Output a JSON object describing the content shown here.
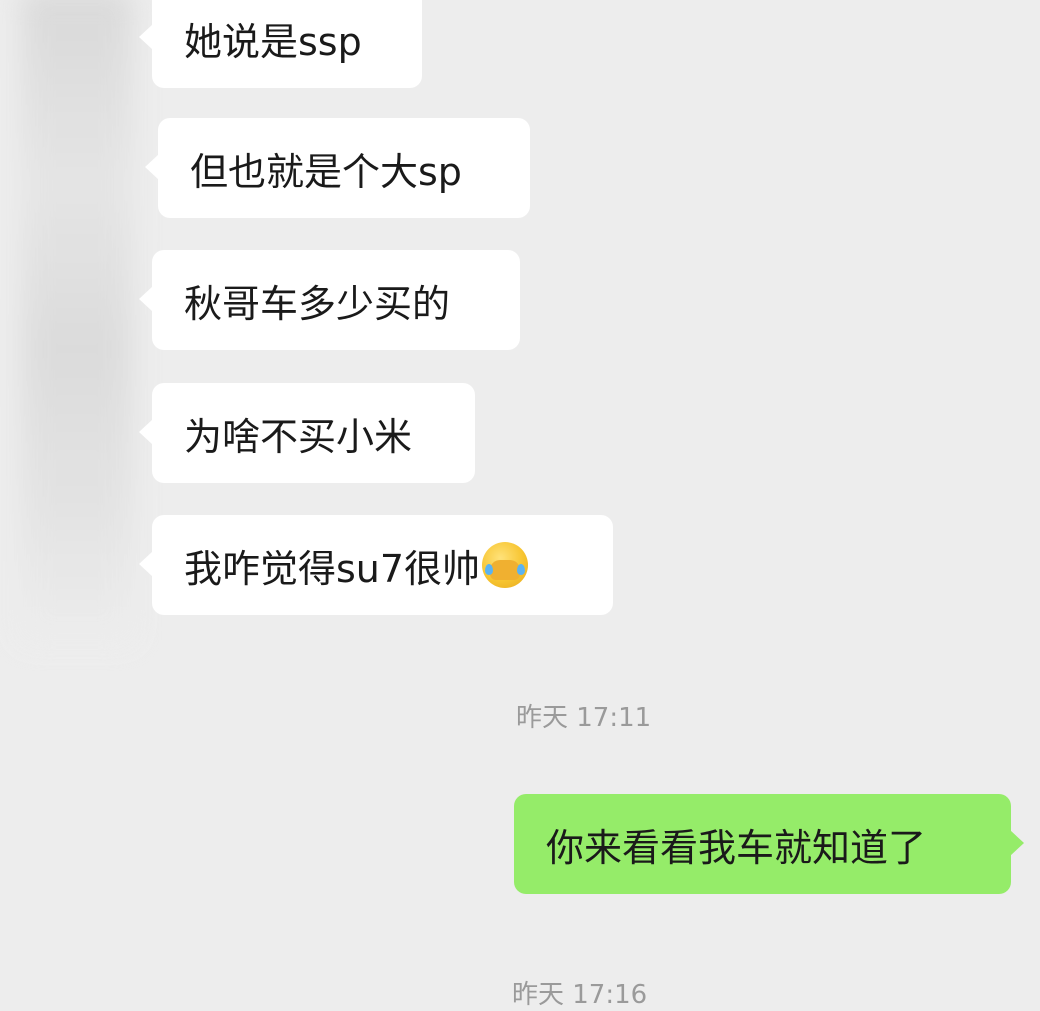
{
  "messages_received": [
    {
      "text": "她说是ssp"
    },
    {
      "text": "但也就是个大sp"
    },
    {
      "text": "秋哥车多少买的"
    },
    {
      "text": "为啥不买小米"
    },
    {
      "text": "我咋觉得su7很帅",
      "emoji": "face-with-tears-of-joy-covering-face-icon"
    }
  ],
  "timestamps": [
    "昨天 17:11",
    "昨天 17:16"
  ],
  "messages_sent": [
    {
      "text": "你来看看我车就知道了"
    }
  ],
  "colors": {
    "background": "#ededed",
    "received_bubble": "#ffffff",
    "sent_bubble": "#95ec69",
    "timestamp_text": "#9a9a9a"
  }
}
